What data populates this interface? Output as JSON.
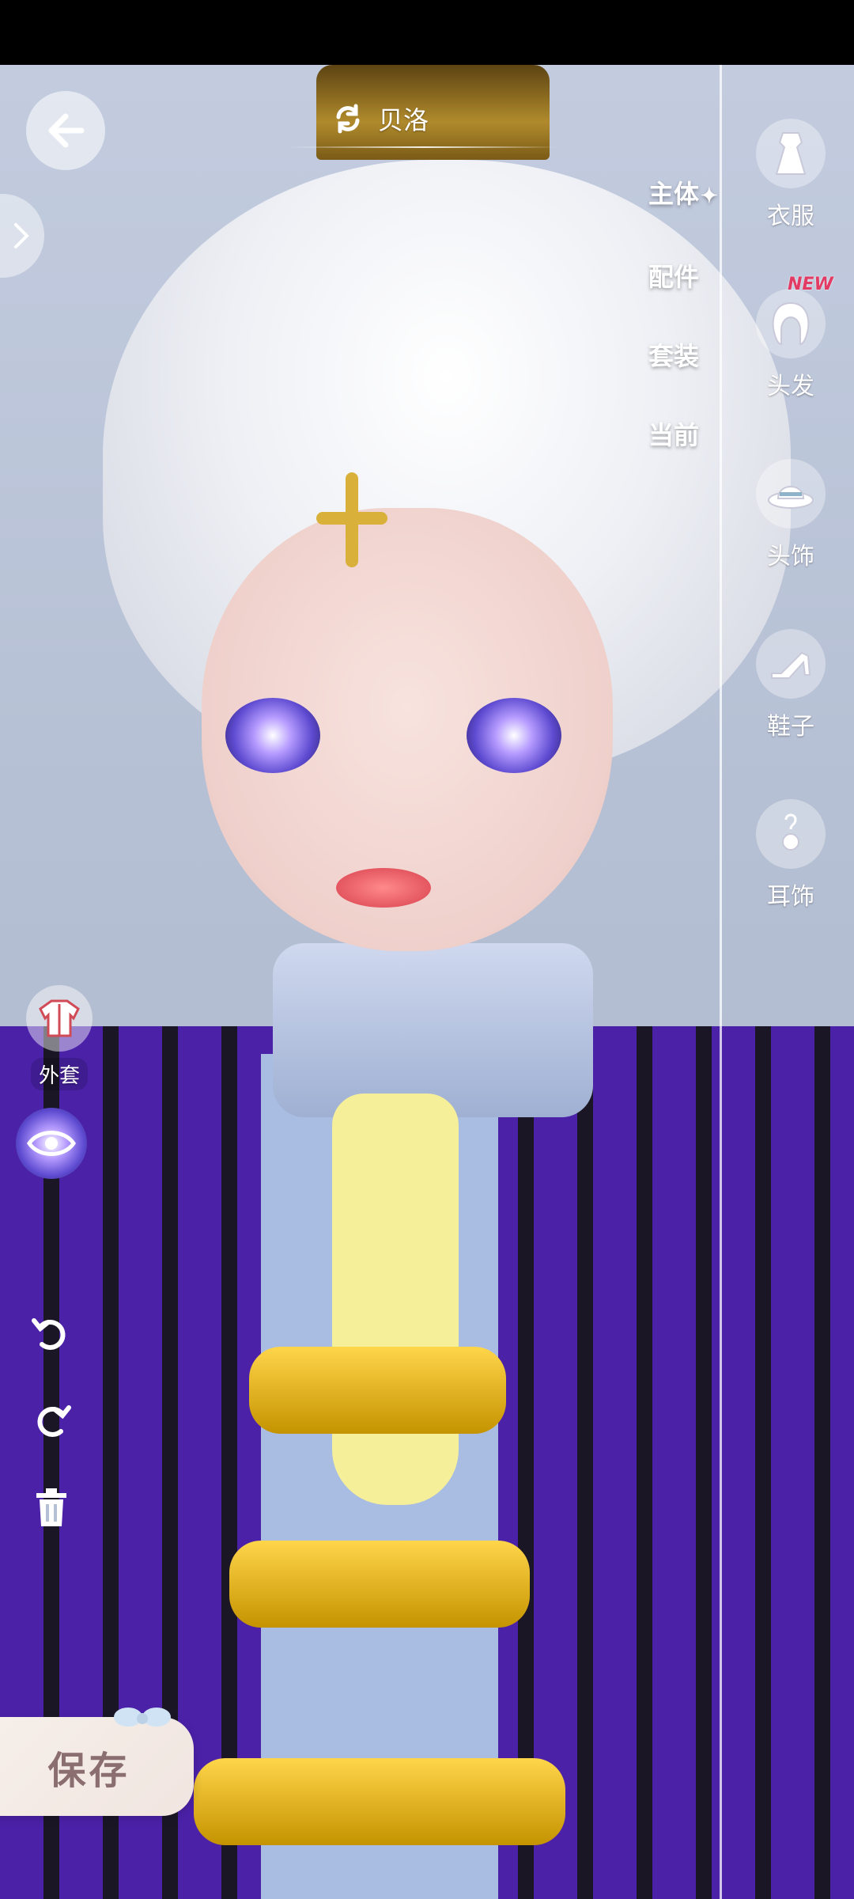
{
  "character": {
    "name": "贝洛"
  },
  "categories": {
    "items": [
      {
        "label": "主体",
        "selected": true,
        "star": "✦"
      },
      {
        "label": "配件"
      },
      {
        "label": "套装"
      },
      {
        "label": "当前"
      }
    ]
  },
  "right_panel": {
    "items": [
      {
        "label": "衣服",
        "icon": "dress-icon"
      },
      {
        "label": "头发",
        "icon": "hair-icon",
        "badge": "NEW"
      },
      {
        "label": "头饰",
        "icon": "hat-icon"
      },
      {
        "label": "鞋子",
        "icon": "shoe-icon"
      },
      {
        "label": "耳饰",
        "icon": "earring-icon"
      }
    ]
  },
  "left_tools": {
    "outerwear_label": "外套"
  },
  "save": {
    "label": "保存"
  },
  "colors": {
    "coat": "#4b21a8",
    "accent_gold": "#d9b13a",
    "new_badge": "#e23b64"
  }
}
